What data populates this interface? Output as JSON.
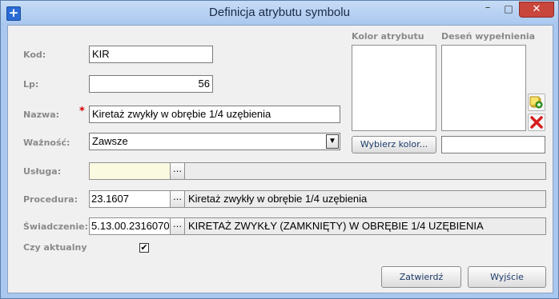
{
  "window": {
    "title": "Definicja atrybutu symbolu",
    "minimize_glyph": "–",
    "maximize_glyph": "□",
    "close_glyph": "✕",
    "app_icon_glyph": "+"
  },
  "form": {
    "kod": {
      "label": "Kod:",
      "value": "KIR"
    },
    "lp": {
      "label": "Lp:",
      "value": "56"
    },
    "nazwa": {
      "label": "Nazwa:",
      "required_mark": "*",
      "value": "Kiretaż zwykły w obrębie 1/4 uzębienia"
    },
    "waznosc": {
      "label": "Ważność:",
      "value": "Zawsze",
      "arrow": "▼"
    },
    "usluga": {
      "label": "Usługa:",
      "code": "",
      "description": "",
      "ellipsis": "…"
    },
    "procedura": {
      "label": "Procedura:",
      "code": "23.1607",
      "description": "Kiretaż zwykły w obrębie 1/4 uzębienia",
      "ellipsis": "…"
    },
    "swiadczenie": {
      "label": "Świadczenie:",
      "code": "5.13.00.2316070",
      "description": "KIRETAŻ ZWYKŁY (ZAMKNIĘTY) W OBRĘBIE 1/4 UZĘBIENIA",
      "ellipsis": "…"
    },
    "czy_aktualny": {
      "label": "Czy aktualny",
      "checked": true,
      "check_glyph": "✔"
    }
  },
  "kolor": {
    "label": "Kolor atrybutu",
    "button_label": "Wybierz kolor..."
  },
  "desen": {
    "label": "Deseń wypełnienia",
    "value": ""
  },
  "buttons": {
    "ok": "Zatwierdź",
    "exit": "Wyjście"
  },
  "icons": {
    "add": "add-pattern-icon",
    "delete": "delete-pattern-icon"
  },
  "colors": {
    "title_bar": "#a9c7ef",
    "close_button": "#c9463d",
    "required": "#d40000",
    "empty_field": "#fafae0"
  }
}
